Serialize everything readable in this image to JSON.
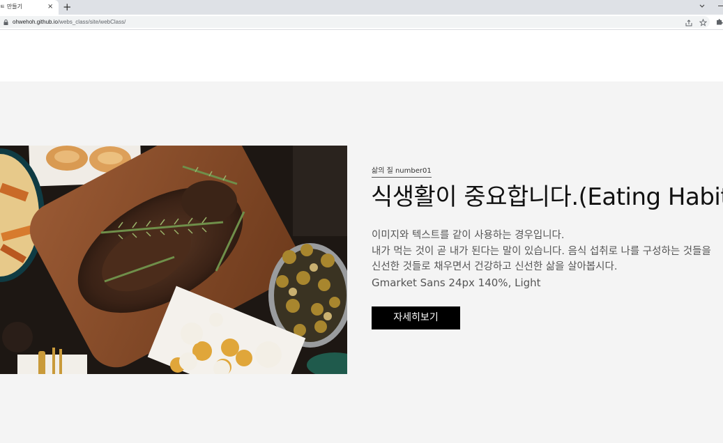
{
  "browser": {
    "tab_title": "ㅌ 만들기",
    "tab_close": "×",
    "new_tab": "+",
    "url_host": "ohwehoh.github.io",
    "url_path": "/webs_class/site/webClass/"
  },
  "content": {
    "sub_label": "삶의 질 number01",
    "headline": "식생활이 중요합니다.(Eating Habits)",
    "desc_lines": [
      "이미지와 텍스트를 같이 사용하는 경우입니다.",
      "내가 먹는 것이 곧 내가 된다는 말이 있습니다. 음식 섭취로 나를 구성하는 것들을",
      "신선한 것들로 채우면서 건강하고 신선한 삶을 살아봅시다.",
      "Gmarket Sans 24px 140%, Light"
    ],
    "button_label": "자세히보기"
  },
  "colors": {
    "section_bg": "#f4f4f4",
    "button_bg": "#000000",
    "button_text": "#ffffff",
    "headline": "#111111",
    "body_text": "#555555"
  },
  "image": {
    "subject": "roast meat with rosemary on a wooden board, cauliflower, potatoes and mushrooms"
  }
}
